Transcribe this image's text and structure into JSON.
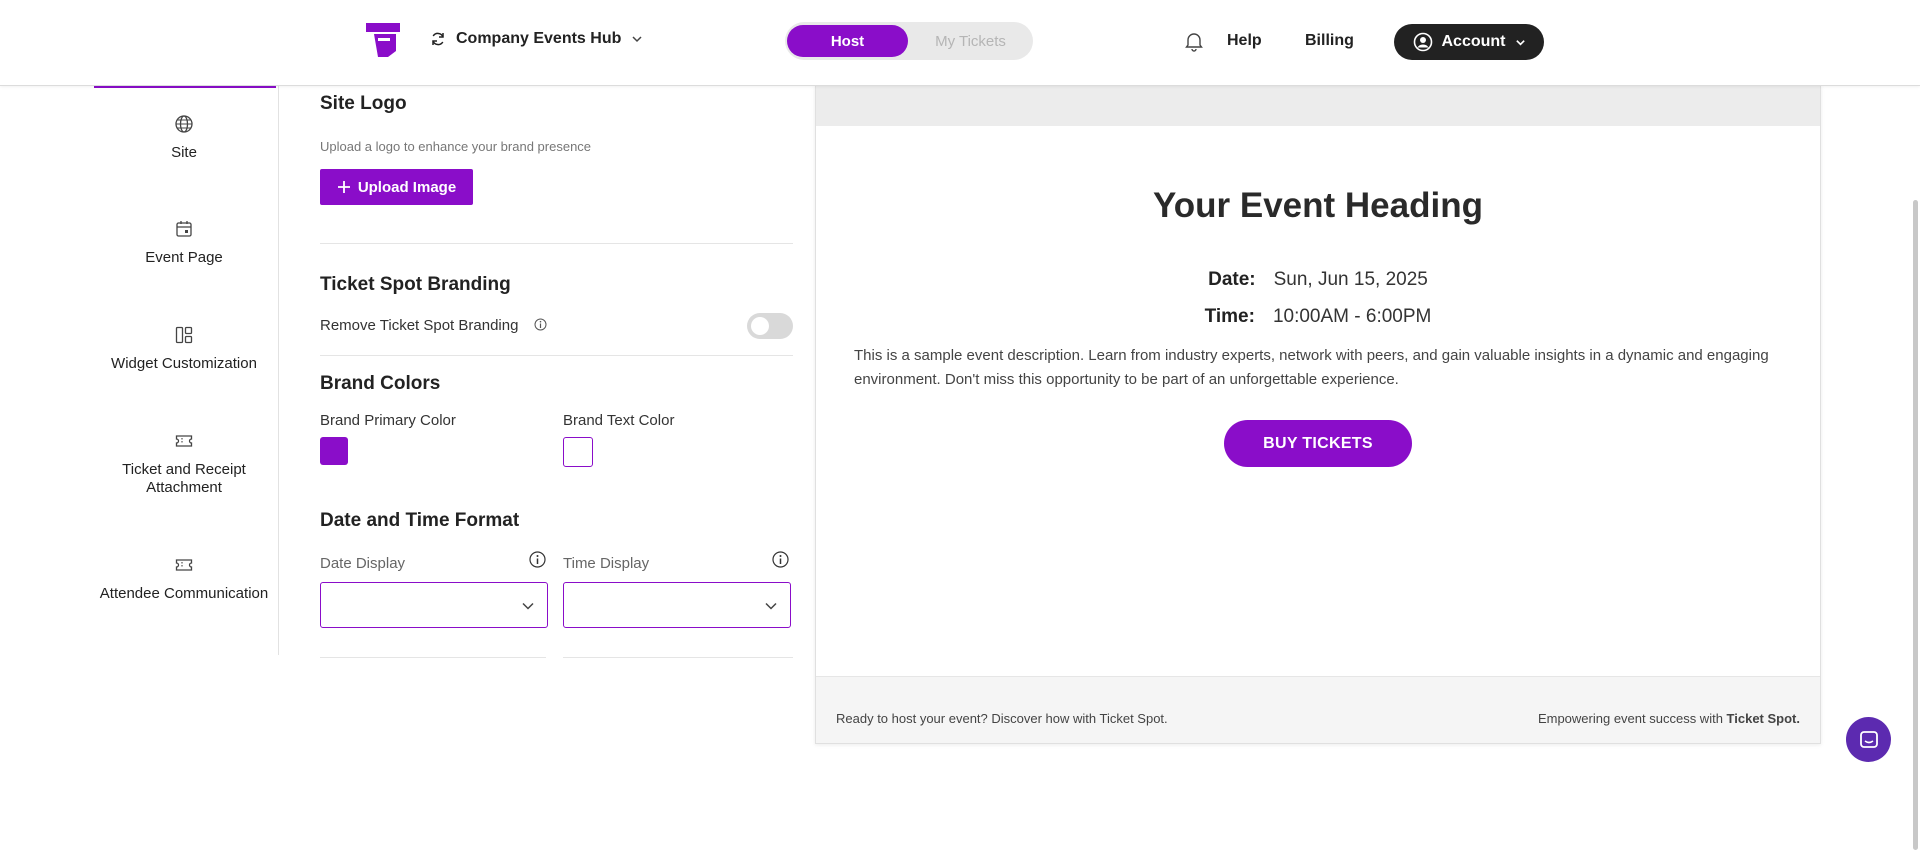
{
  "header": {
    "workspace": "Company Events Hub",
    "modes": {
      "host": "Host",
      "tickets": "My Tickets"
    },
    "help": "Help",
    "billing": "Billing",
    "account": "Account"
  },
  "sidebar": {
    "items": [
      {
        "label": "Site",
        "icon": "globe-icon"
      },
      {
        "label": "Event Page",
        "icon": "calendar-icon"
      },
      {
        "label": "Widget Customization",
        "icon": "layout-icon"
      },
      {
        "label": "Ticket and Receipt Attachment",
        "icon": "ticket-icon"
      },
      {
        "label": "Attendee Communication",
        "icon": "ticket-icon"
      }
    ]
  },
  "settings": {
    "site_logo": {
      "title": "Site Logo",
      "hint": "Upload a logo to enhance your brand presence",
      "upload_label": "Upload Image"
    },
    "branding": {
      "title": "Ticket Spot Branding",
      "remove_label": "Remove Ticket Spot Branding",
      "remove_enabled": false
    },
    "colors": {
      "title": "Brand Colors",
      "primary_label": "Brand Primary Color",
      "primary_value": "#8a0dc9",
      "text_label": "Brand Text Color",
      "text_value": "#ffffff"
    },
    "datetime": {
      "title": "Date and Time Format",
      "date_label": "Date Display",
      "date_value": "",
      "time_label": "Time Display",
      "time_value": ""
    }
  },
  "preview": {
    "heading": "Your Event Heading",
    "date_label": "Date:",
    "date_value": "Sun, Jun 15, 2025",
    "time_label": "Time:",
    "time_value": "10:00AM - 6:00PM",
    "description": "This is a sample event description. Learn from industry experts, network with peers, and gain valuable insights in a dynamic and engaging environment. Don't miss this opportunity to be part of an unforgettable experience.",
    "button": "BUY TICKETS",
    "footer_left": "Ready to host your event? Discover how with Ticket Spot.",
    "footer_right_prefix": "Empowering event success with ",
    "footer_right_brand": "Ticket Spot."
  },
  "colors": {
    "accent": "#8a0dc9",
    "dark": "#222222",
    "chat": "#5c2ab0"
  }
}
